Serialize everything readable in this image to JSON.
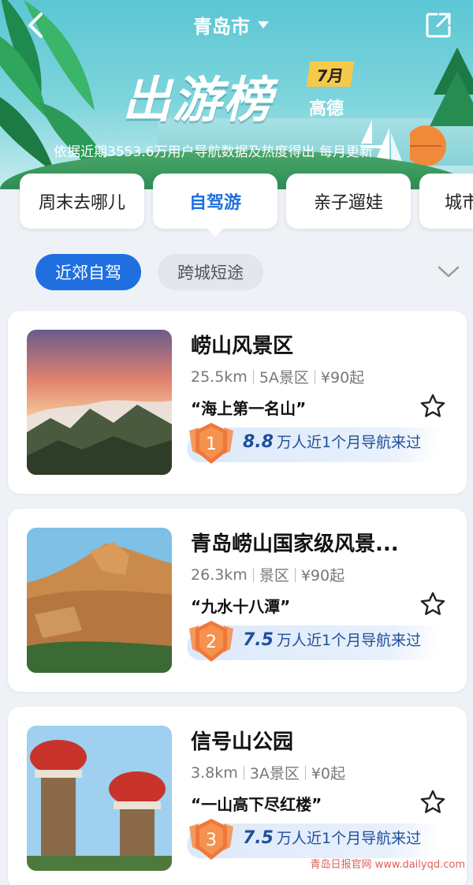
{
  "header": {
    "city": "青岛市",
    "title": "出游榜",
    "month_badge": "7月",
    "brand": "高德",
    "subtitle": "依据近期3553.6万用户导航数据及热度得出 每月更新"
  },
  "category_tabs": [
    {
      "label": "周末去哪儿",
      "active": false
    },
    {
      "label": "自驾游",
      "active": true
    },
    {
      "label": "亲子遛娃",
      "active": false
    },
    {
      "label": "城市",
      "active": false
    }
  ],
  "sub_tabs": [
    {
      "label": "近郊自驾",
      "active": true
    },
    {
      "label": "跨城短途",
      "active": false
    }
  ],
  "cards": [
    {
      "rank": "1",
      "name": "崂山风景区",
      "distance": "25.5km",
      "level": "5A景区",
      "price": "¥90起",
      "slogan": "“海上第一名山”",
      "nav_count": "8.8",
      "nav_text": "万人近1个月导航来过"
    },
    {
      "rank": "2",
      "name": "青岛崂山国家级风景...",
      "distance": "26.3km",
      "level": "景区",
      "price": "¥90起",
      "slogan": "“九水十八潭”",
      "nav_count": "7.5",
      "nav_text": "万人近1个月导航来过"
    },
    {
      "rank": "3",
      "name": "信号山公园",
      "distance": "3.8km",
      "level": "3A景区",
      "price": "¥0起",
      "slogan": "“一山高下尽红楼”",
      "nav_count": "7.5",
      "nav_text": "万人近1个月导航来过"
    }
  ],
  "watermark": "青岛日报官网 www.dailyqd.com",
  "colors": {
    "accent": "#1f6fe0",
    "medal": "#f0773a",
    "stat_text": "#1e4f9a"
  }
}
